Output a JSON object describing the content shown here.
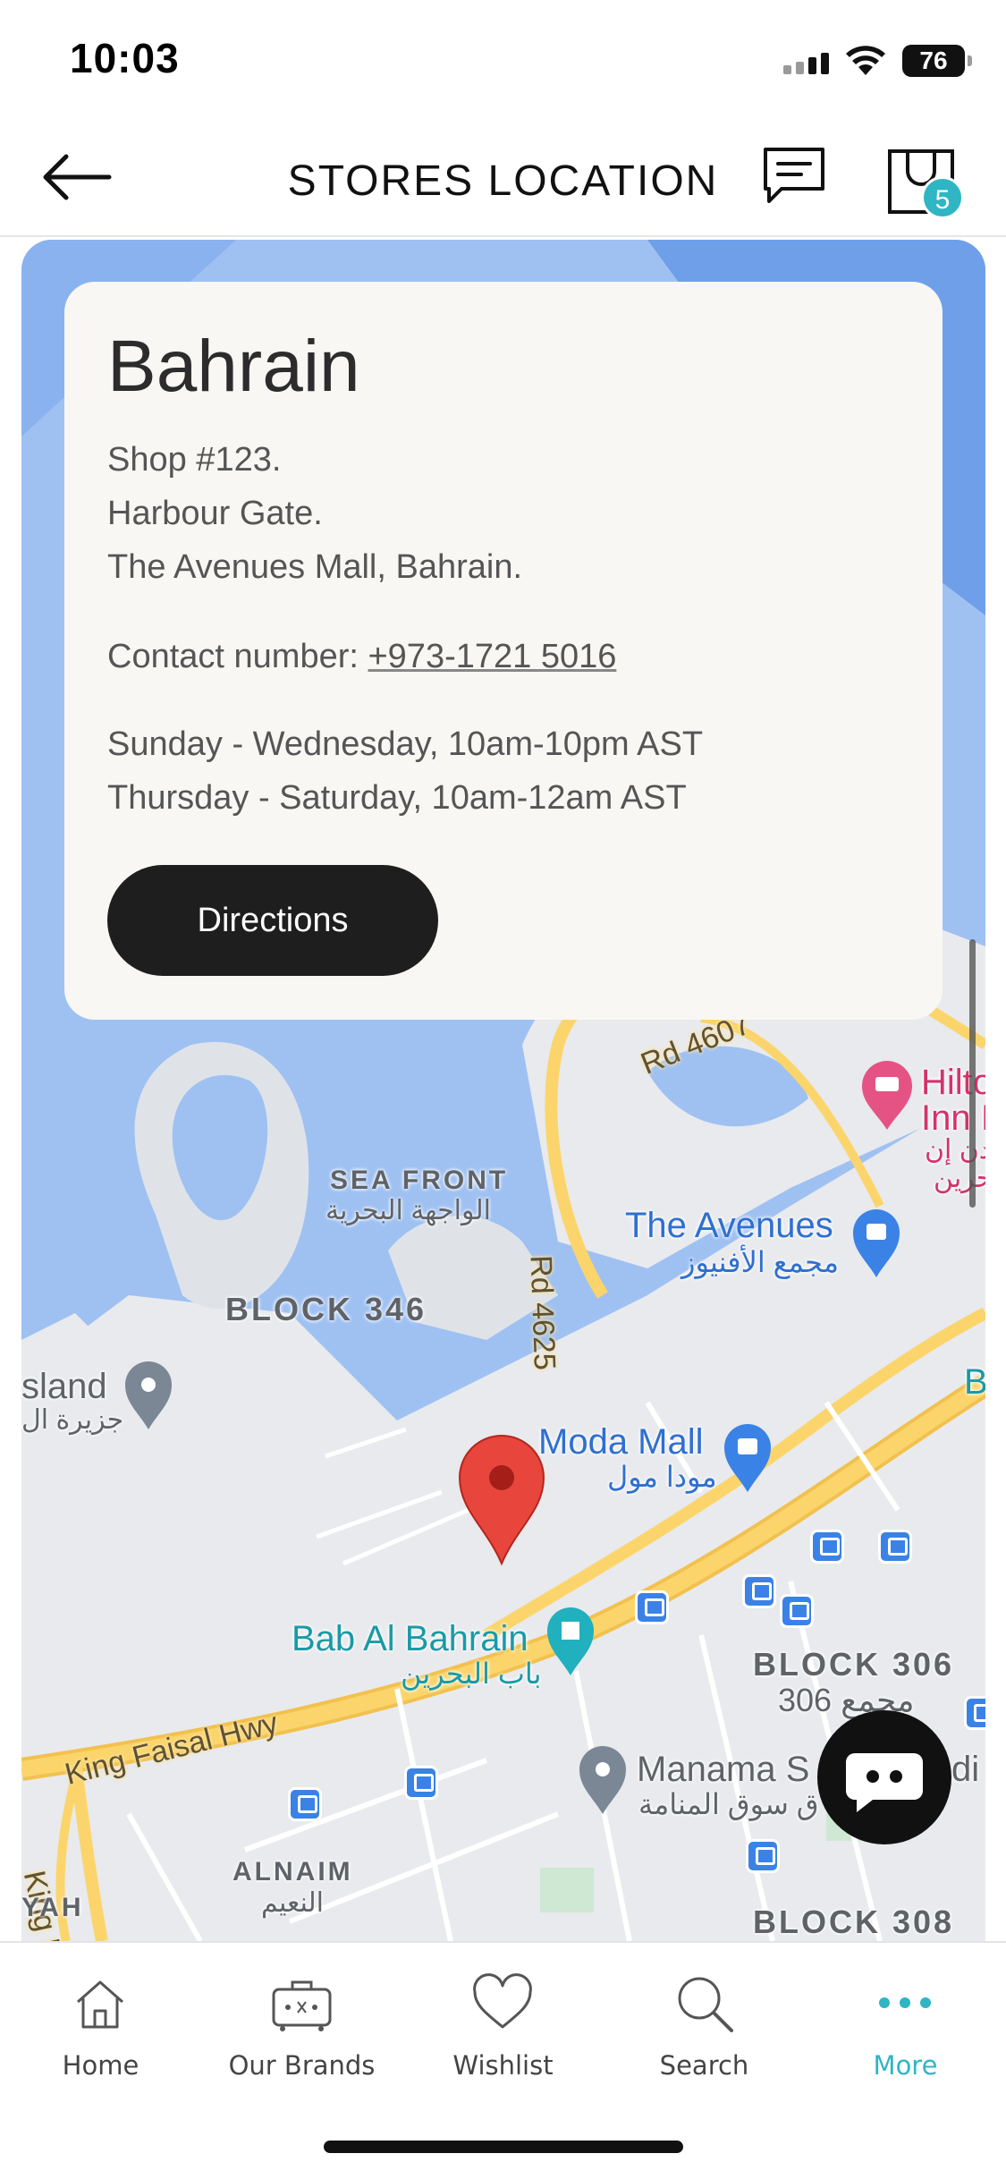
{
  "status_bar": {
    "time": "10:03",
    "battery": "76",
    "icons": [
      "cellular-signal-icon",
      "wifi-icon",
      "battery-icon"
    ]
  },
  "header": {
    "title": "STORES LOCATION",
    "back_icon": "arrow-left-icon",
    "chat_icon": "message-icon",
    "bag_icon": "shopping-bag-icon",
    "bag_count": "5"
  },
  "store": {
    "name": "Bahrain",
    "address_lines": [
      "Shop #123.",
      "Harbour Gate.",
      "The Avenues Mall, Bahrain."
    ],
    "contact_label": "Contact number:",
    "phone": "+973-1721 5016",
    "hours": [
      "Sunday - Wednesday, 10am-10pm AST",
      "Thursday - Saturday, 10am-12am AST"
    ],
    "directions_label": "Directions"
  },
  "map": {
    "labels": {
      "hilton_1": "Hilto",
      "hilton_2": "Inn I",
      "hilton_ar_1": "لدن إن",
      "hilton_ar_2": "حرين",
      "rd_4607": "Rd 4607",
      "rd_4625": "Rd 4625",
      "sea_front": "SEA FRONT",
      "sea_front_ar": "الواجهة البحرية",
      "the_avenues": "The Avenues",
      "the_avenues_ar": "مجمع الأفنيوز",
      "block_346": "BLOCK 346",
      "island": "sland",
      "island_ar": "جزيرة ال",
      "moda_mall": "Moda Mall",
      "moda_mall_ar": "مودا مول",
      "edge_b": "B",
      "bab_al_bahrain": "Bab Al Bahrain",
      "bab_al_bahrain_ar": "باب البحرين",
      "block_306": "BLOCK 306",
      "block_306_ar": "306 مجمع",
      "king_faisal_hwy": "King Faisal Hwy",
      "king_fais": "King Fais",
      "manama_souq": "Manama S",
      "manama_souq_ar": "ق سوق المنامة",
      "manama_souq_end": "di",
      "alnaim": "ALNAIM",
      "alnaim_ar": "النعيم",
      "yah": "YAH",
      "block_308": "BLOCK 308"
    },
    "colors": {
      "water": "#9fc1f2",
      "land": "#e9ebee",
      "road": "#fbd56b",
      "marker": "#e8453c",
      "poi_blue": "#3b82e6",
      "poi_pink": "#e55385",
      "poi_teal": "#21b0bd"
    }
  },
  "chat_fab_icon": "chat-bubble-icon",
  "bottom_nav": {
    "items": [
      {
        "label": "Home",
        "icon": "home-icon"
      },
      {
        "label": "Our Brands",
        "icon": "luggage-icon"
      },
      {
        "label": "Wishlist",
        "icon": "heart-icon"
      },
      {
        "label": "Search",
        "icon": "search-icon"
      },
      {
        "label": "More",
        "icon": "more-dots-icon"
      }
    ],
    "active": "More",
    "active_color": "#2fb5c3"
  }
}
